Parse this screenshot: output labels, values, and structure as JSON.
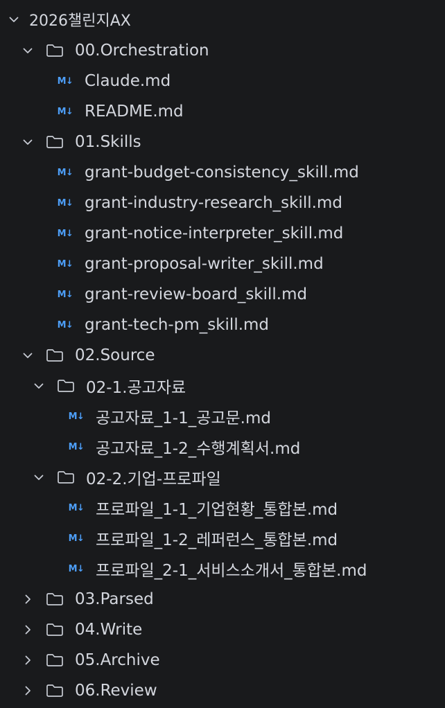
{
  "explorer": {
    "root": {
      "label": "2026챌린지AX",
      "icon": "chevron-down-icon"
    },
    "items": [
      {
        "kind": "folder",
        "label": "00.Orchestration",
        "expanded": true
      },
      {
        "kind": "file",
        "label": "Claude.md",
        "icon": "markdown-icon",
        "icon_text": "M↓"
      },
      {
        "kind": "file",
        "label": "README.md",
        "icon": "markdown-icon",
        "icon_text": "M↓"
      },
      {
        "kind": "folder",
        "label": "01.Skills",
        "expanded": true
      },
      {
        "kind": "file",
        "label": "grant-budget-consistency_skill.md",
        "icon": "markdown-icon",
        "icon_text": "M↓"
      },
      {
        "kind": "file",
        "label": "grant-industry-research_skill.md",
        "icon": "markdown-icon",
        "icon_text": "M↓"
      },
      {
        "kind": "file",
        "label": "grant-notice-interpreter_skill.md",
        "icon": "markdown-icon",
        "icon_text": "M↓"
      },
      {
        "kind": "file",
        "label": "grant-proposal-writer_skill.md",
        "icon": "markdown-icon",
        "icon_text": "M↓"
      },
      {
        "kind": "file",
        "label": "grant-review-board_skill.md",
        "icon": "markdown-icon",
        "icon_text": "M↓"
      },
      {
        "kind": "file",
        "label": "grant-tech-pm_skill.md",
        "icon": "markdown-icon",
        "icon_text": "M↓"
      },
      {
        "kind": "folder",
        "label": "02.Source",
        "expanded": true
      },
      {
        "kind": "folder",
        "label": "02-1.공고자료",
        "expanded": true
      },
      {
        "kind": "file",
        "label": "공고자료_1-1_공고문.md",
        "icon": "markdown-icon",
        "icon_text": "M↓"
      },
      {
        "kind": "file",
        "label": "공고자료_1-2_수행계획서.md",
        "icon": "markdown-icon",
        "icon_text": "M↓"
      },
      {
        "kind": "folder",
        "label": "02-2.기업-프로파일",
        "expanded": true
      },
      {
        "kind": "file",
        "label": "프로파일_1-1_기업현황_통합본.md",
        "icon": "markdown-icon",
        "icon_text": "M↓"
      },
      {
        "kind": "file",
        "label": "프로파일_1-2_레퍼런스_통합본.md",
        "icon": "markdown-icon",
        "icon_text": "M↓"
      },
      {
        "kind": "file",
        "label": "프로파일_2-1_서비스소개서_통합본.md",
        "icon": "markdown-icon",
        "icon_text": "M↓"
      },
      {
        "kind": "folder",
        "label": "03.Parsed",
        "expanded": false
      },
      {
        "kind": "folder",
        "label": "04.Write",
        "expanded": false
      },
      {
        "kind": "folder",
        "label": "05.Archive",
        "expanded": false
      },
      {
        "kind": "folder",
        "label": "06.Review",
        "expanded": false
      }
    ]
  }
}
